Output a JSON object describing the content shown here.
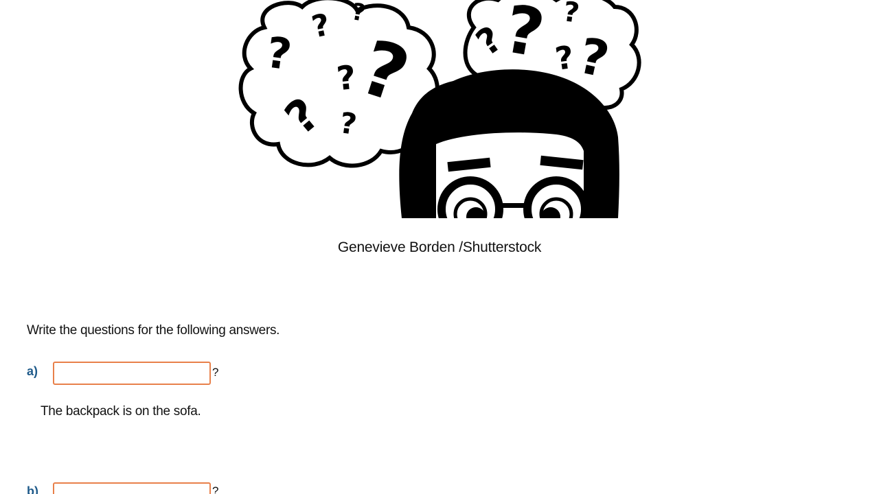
{
  "image_credit": "Genevieve Borden /Shutterstock",
  "instructions": "Write the questions for the following answers.",
  "items": [
    {
      "label": "a)",
      "input_value": "",
      "question_mark": "?",
      "answer": "The backpack is on the sofa."
    },
    {
      "label": "b)",
      "input_value": "",
      "question_mark": "?",
      "answer": ""
    }
  ],
  "colors": {
    "label": "#1e5a8a",
    "input_border": "#e8804a",
    "text": "#111111"
  },
  "illustration": {
    "icon": "confused-person-question-marks-icon"
  }
}
